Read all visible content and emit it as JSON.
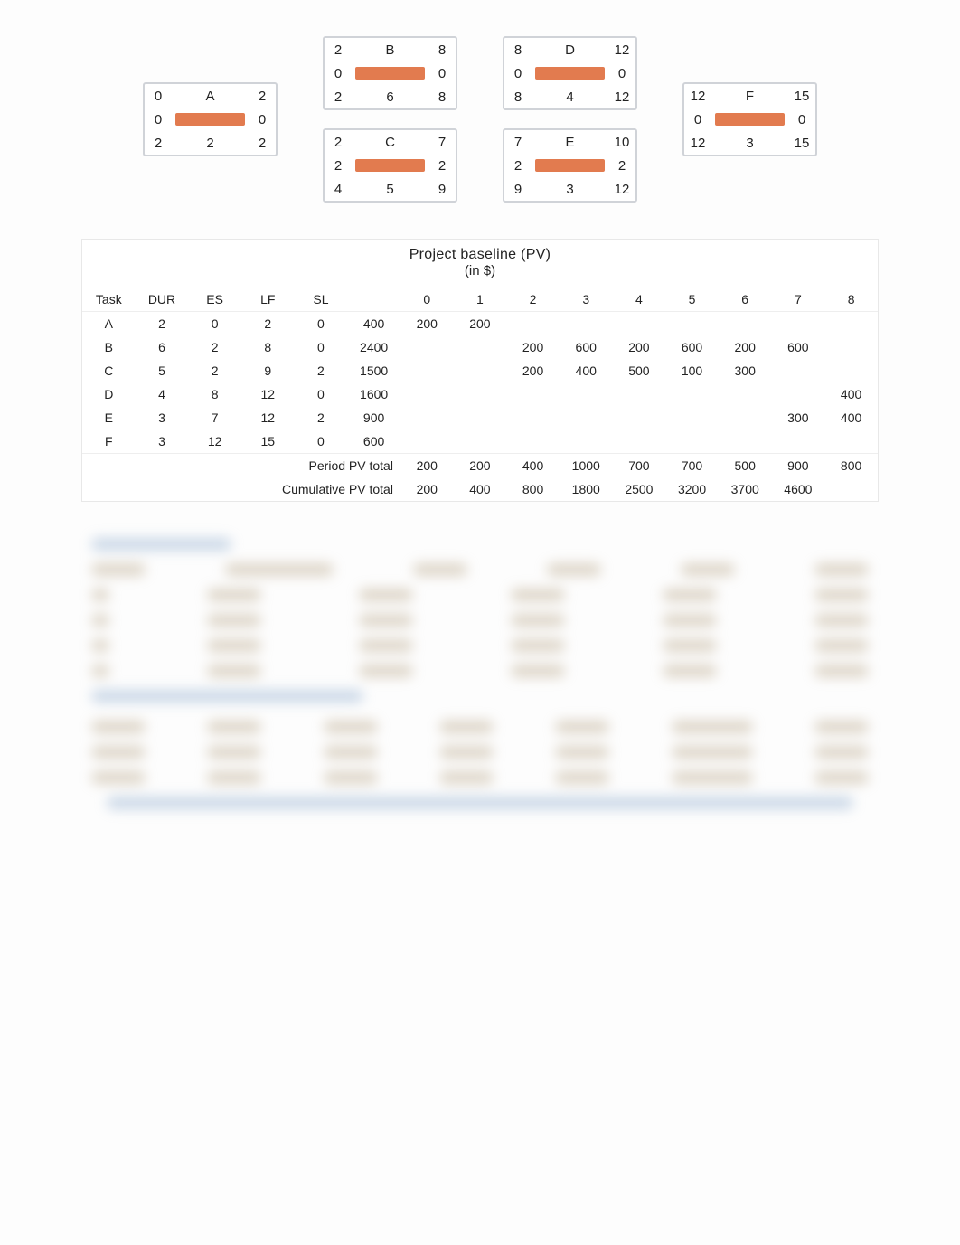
{
  "network": {
    "nodes": [
      {
        "id": "A",
        "es": 0,
        "name": "A",
        "ef": 2,
        "sl_l": 0,
        "sl_r": 0,
        "ls": 2,
        "dur": 2,
        "lf": 2
      },
      {
        "id": "B",
        "es": 2,
        "name": "B",
        "ef": 8,
        "sl_l": 0,
        "sl_r": 0,
        "ls": 2,
        "dur": 6,
        "lf": 8
      },
      {
        "id": "C",
        "es": 2,
        "name": "C",
        "ef": 7,
        "sl_l": 2,
        "sl_r": 2,
        "ls": 4,
        "dur": 5,
        "lf": 9
      },
      {
        "id": "D",
        "es": 8,
        "name": "D",
        "ef": 12,
        "sl_l": 0,
        "sl_r": 0,
        "ls": 8,
        "dur": 4,
        "lf": 12
      },
      {
        "id": "E",
        "es": 7,
        "name": "E",
        "ef": 10,
        "sl_l": 2,
        "sl_r": 2,
        "ls": 9,
        "dur": 3,
        "lf": 12
      },
      {
        "id": "F",
        "es": 12,
        "name": "F",
        "ef": 15,
        "sl_l": 0,
        "sl_r": 0,
        "ls": 12,
        "dur": 3,
        "lf": 15
      }
    ]
  },
  "pv_table": {
    "title": "Project baseline (PV)",
    "subtitle": "(in $)",
    "headers_left": [
      "Task",
      "DUR",
      "ES",
      "LF",
      "SL",
      ""
    ],
    "periods": [
      "0",
      "1",
      "2",
      "3",
      "4",
      "5",
      "6",
      "7",
      "8"
    ],
    "rows": [
      {
        "task": "A",
        "dur": 2,
        "es": 0,
        "lf": 2,
        "sl": 0,
        "total": 400,
        "cells": [
          200,
          200,
          "",
          "",
          "",
          "",
          "",
          "",
          ""
        ]
      },
      {
        "task": "B",
        "dur": 6,
        "es": 2,
        "lf": 8,
        "sl": 0,
        "total": 2400,
        "cells": [
          "",
          "",
          200,
          600,
          200,
          600,
          200,
          600,
          ""
        ]
      },
      {
        "task": "C",
        "dur": 5,
        "es": 2,
        "lf": 9,
        "sl": 2,
        "total": 1500,
        "cells": [
          "",
          "",
          200,
          400,
          500,
          100,
          300,
          "",
          ""
        ]
      },
      {
        "task": "D",
        "dur": 4,
        "es": 8,
        "lf": 12,
        "sl": 0,
        "total": 1600,
        "cells": [
          "",
          "",
          "",
          "",
          "",
          "",
          "",
          "",
          400
        ]
      },
      {
        "task": "E",
        "dur": 3,
        "es": 7,
        "lf": 12,
        "sl": 2,
        "total": 900,
        "cells": [
          "",
          "",
          "",
          "",
          "",
          "",
          "",
          300,
          400
        ]
      },
      {
        "task": "F",
        "dur": 3,
        "es": 12,
        "lf": 15,
        "sl": 0,
        "total": 600,
        "cells": [
          "",
          "",
          "",
          "",
          "",
          "",
          "",
          "",
          ""
        ]
      }
    ],
    "period_label": "Period PV total",
    "period_totals": [
      200,
      200,
      400,
      1000,
      700,
      700,
      500,
      900,
      800
    ],
    "cum_label": "Cumulative PV total",
    "cum_totals": [
      200,
      400,
      800,
      1800,
      2500,
      3200,
      3700,
      4600,
      ""
    ]
  }
}
